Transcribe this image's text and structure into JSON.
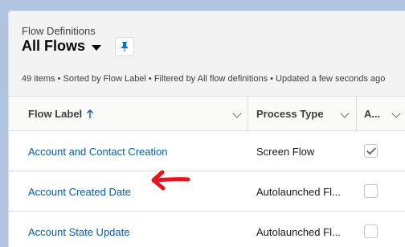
{
  "header": {
    "object_label": "Flow Definitions",
    "list_view_title": "All Flows",
    "list_info": "49 items • Sorted by Flow Label • Filtered by All flow definitions • Updated a few seconds ago"
  },
  "table": {
    "columns": [
      {
        "label": "Flow Label",
        "sort": "ascending"
      },
      {
        "label": "Process Type"
      },
      {
        "label": "A..."
      }
    ],
    "rows": [
      {
        "flow_label": "Account and Contact Creation",
        "process_type": "Screen Flow",
        "active": true
      },
      {
        "flow_label": "Account Created Date",
        "process_type": "Autolaunched Fl...",
        "active": false
      },
      {
        "flow_label": "Account State Update",
        "process_type": "Autolaunched Fl...",
        "active": false
      }
    ]
  },
  "colors": {
    "background": "#b0c4df",
    "link": "#0b5cab",
    "annotation": "#e8131d",
    "brand": "#0176d3"
  },
  "icons": {
    "pin": "pin-icon",
    "list_chevron": "chevron-down-icon",
    "sort": "arrow-up-icon",
    "annotation": "arrow-left-annotation"
  }
}
